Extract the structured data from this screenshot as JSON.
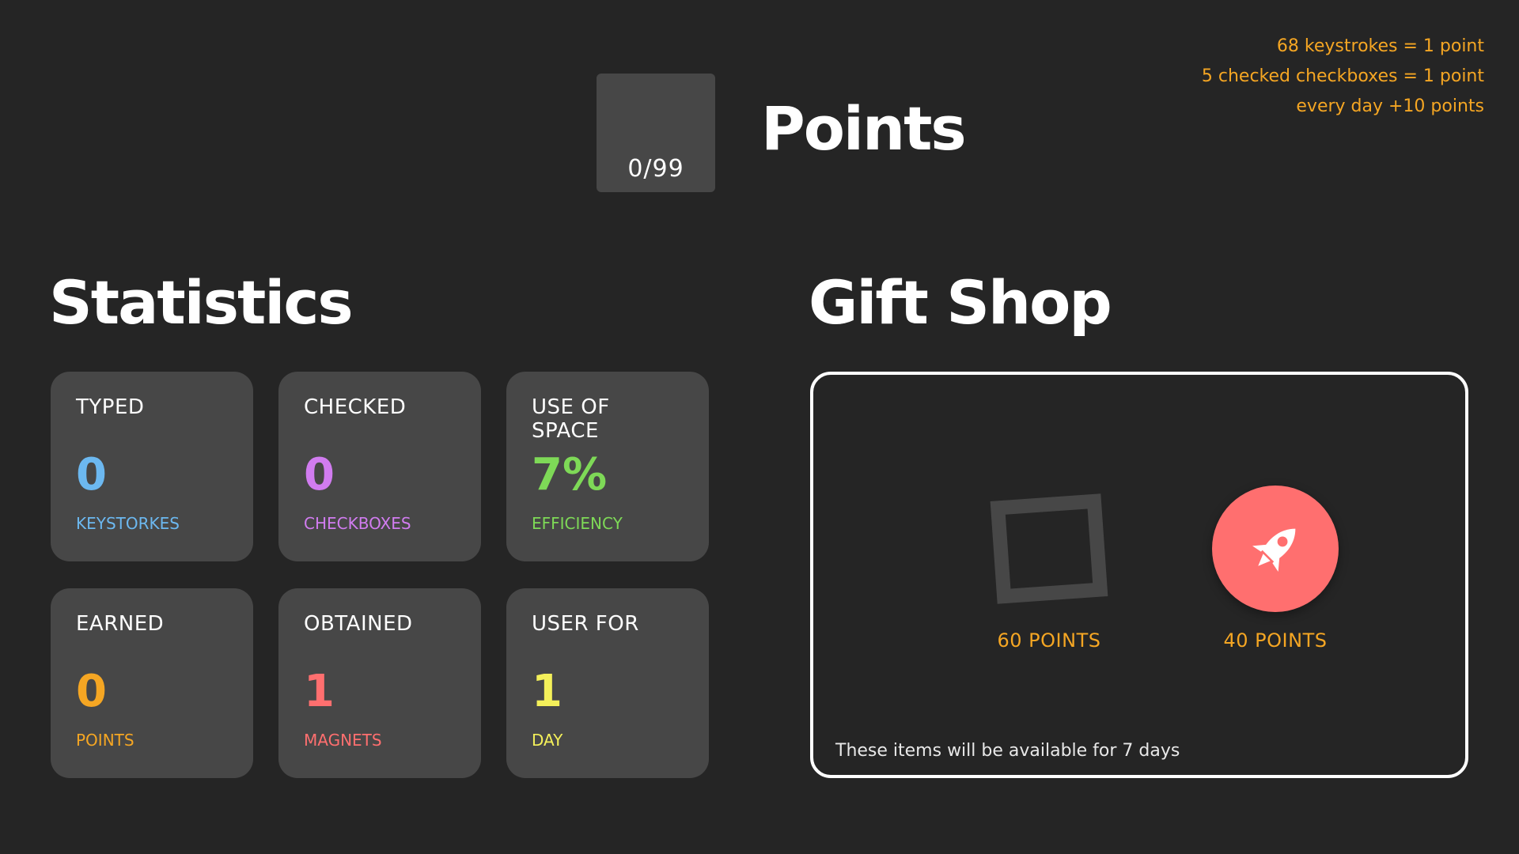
{
  "header": {
    "points_counter": "0/99",
    "title": "Points"
  },
  "rules": {
    "lines": [
      "68 keystrokes = 1 point",
      "5 checked checkboxes = 1 point",
      "every day +10 points"
    ]
  },
  "statistics": {
    "title": "Statistics",
    "cards": [
      {
        "label": "TYPED",
        "value": "0",
        "unit": "KEYSTORKES",
        "color": "#6cb8f0"
      },
      {
        "label": "CHECKED",
        "value": "0",
        "unit": "CHECKBOXES",
        "color": "#d17cf0"
      },
      {
        "label": "USE OF SPACE",
        "value": "7%",
        "unit": "EFFICIENCY",
        "color": "#7ed957"
      },
      {
        "label": "EARNED",
        "value": "0",
        "unit": "POINTS",
        "color": "#f5a623"
      },
      {
        "label": "OBTAINED",
        "value": "1",
        "unit": "MAGNETS",
        "color": "#ff6f6f"
      },
      {
        "label": "USER FOR",
        "value": "1",
        "unit": "DAY",
        "color": "#f4f05a"
      }
    ]
  },
  "gift_shop": {
    "title": "Gift Shop",
    "items": [
      {
        "icon": "frame-square-icon",
        "price": "60 POINTS"
      },
      {
        "icon": "rocket-icon",
        "price": "40 POINTS",
        "color": "#ff6f6f"
      }
    ],
    "note": "These items will be available for 7 days"
  }
}
